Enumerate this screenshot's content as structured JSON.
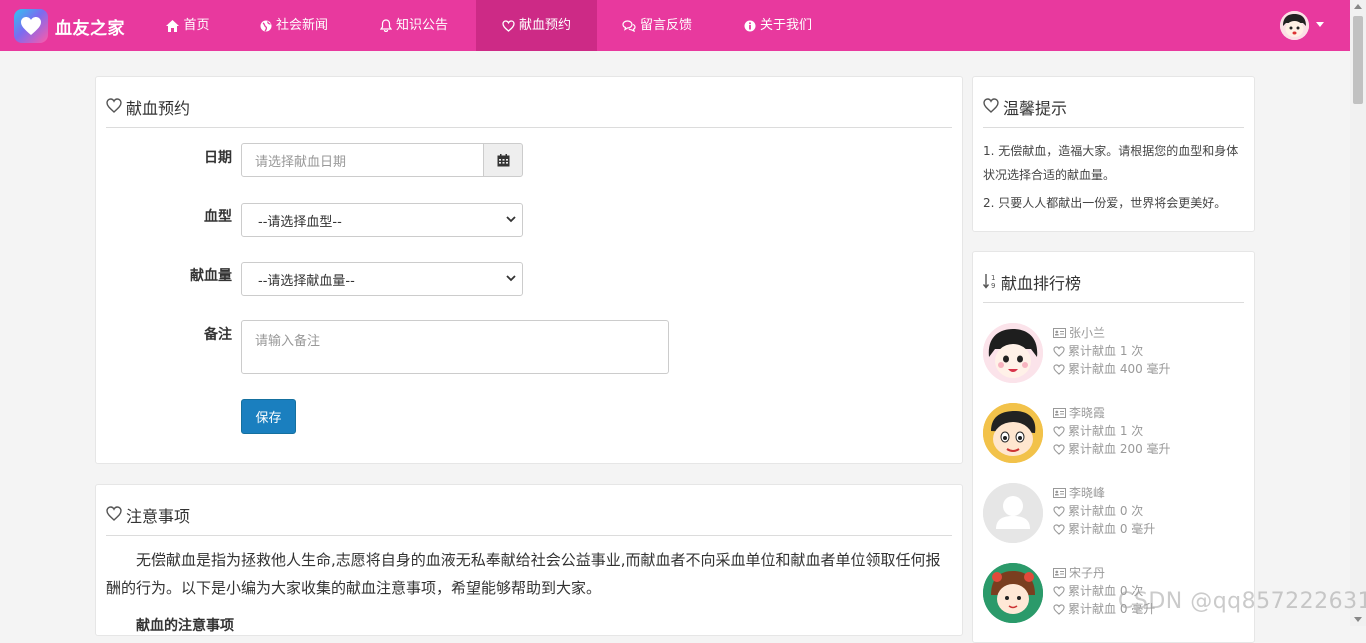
{
  "brand": {
    "name": "血友之家"
  },
  "nav": {
    "items": [
      {
        "label": "首页"
      },
      {
        "label": "社会新闻"
      },
      {
        "label": "知识公告"
      },
      {
        "label": "献血预约"
      },
      {
        "label": "留言反馈"
      },
      {
        "label": "关于我们"
      }
    ],
    "active": "献血预约"
  },
  "booking": {
    "title": "献血预约",
    "date_label": "日期",
    "date_placeholder": "请选择献血日期",
    "blood_type_label": "血型",
    "blood_type_selected": "--请选择血型--",
    "amount_label": "献血量",
    "amount_selected": "--请选择献血量--",
    "note_label": "备注",
    "note_placeholder": "请输入备注",
    "save_label": "保存"
  },
  "tips": {
    "title": "温馨提示",
    "items": [
      "1. 无偿献血，造福大家。请根据您的血型和身体状况选择合适的献血量。",
      "2. 只要人人都献出一份爱，世界将会更美好。"
    ]
  },
  "ranking": {
    "title": "献血排行榜",
    "entries": [
      {
        "name": "张小兰",
        "times": "累计献血 1 次",
        "volume": "累计献血 400 毫升"
      },
      {
        "name": "李晓霞",
        "times": "累计献血 1 次",
        "volume": "累计献血 200 毫升"
      },
      {
        "name": "李晓峰",
        "times": "累计献血 0 次",
        "volume": "累计献血 0 毫升"
      },
      {
        "name": "宋子丹",
        "times": "累计献血 0 次",
        "volume": "累计献血 0 毫升"
      }
    ]
  },
  "notice": {
    "title": "注意事项",
    "paragraph": "无偿献血是指为拯救他人生命,志愿将自身的血液无私奉献给社会公益事业,而献血者不向采血单位和献血者单位领取任何报酬的行为。以下是小编为大家收集的献血注意事项，希望能够帮助到大家。",
    "subheading": "献血的注意事项"
  },
  "watermark": "CSDN @qq857222631",
  "colors": {
    "navbar": "#e8399e",
    "navbar_active": "#cd2a86",
    "button": "#1a7fbf"
  }
}
